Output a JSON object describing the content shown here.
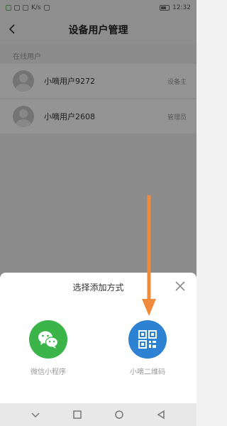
{
  "status_bar": {
    "network": "K/s",
    "time": "12:32"
  },
  "header": {
    "title": "设备用户管理"
  },
  "section": {
    "label": "在线用户"
  },
  "users": [
    {
      "name": "小嘀用户9272",
      "role": "设备主"
    },
    {
      "name": "小嘀用户2608",
      "role": "管理员"
    }
  ],
  "sheet": {
    "title": "选择添加方式",
    "options": [
      {
        "label": "微信小程序",
        "icon": "wechat-icon",
        "color": "#3bb54a"
      },
      {
        "label": "小嘀二维码",
        "icon": "qr-code-icon",
        "color": "#2e82d4"
      }
    ]
  },
  "colors": {
    "arrow": "#f08a3c"
  }
}
